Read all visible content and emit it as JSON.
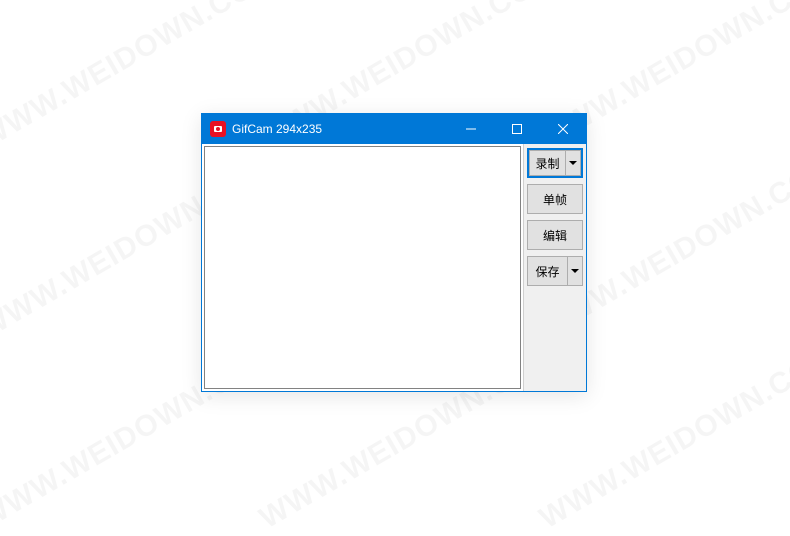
{
  "watermark_text": "WWW.WEIDOWN.COM",
  "titlebar": {
    "title": "GifCam 294x235"
  },
  "controls": {
    "minimize": "—",
    "maximize": "☐",
    "close": "✕"
  },
  "sidebar": {
    "record_label": "录制",
    "frame_label": "单帧",
    "edit_label": "编辑",
    "save_label": "保存"
  }
}
